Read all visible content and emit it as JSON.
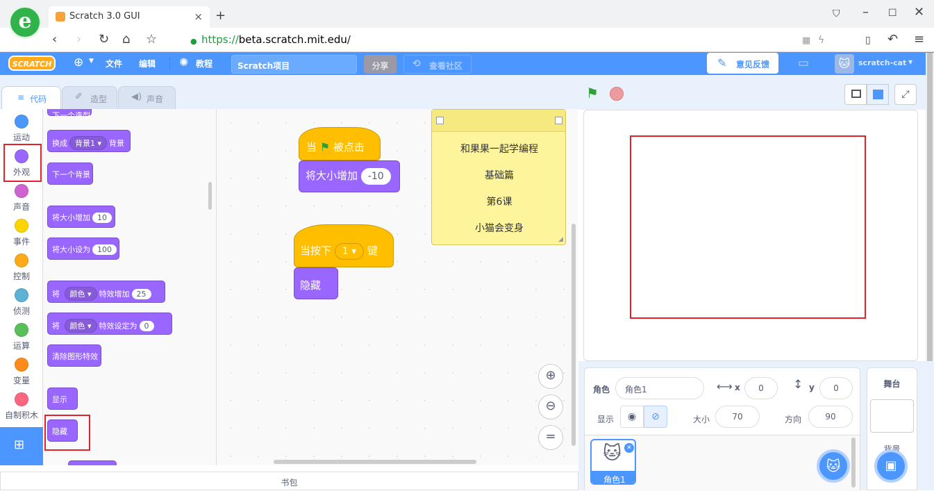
{
  "browser": {
    "tab_title": "Scratch 3.0 GUI",
    "url_scheme": "https://",
    "url_host": "beta.scratch.mit.edu",
    "url_path": "/"
  },
  "menubar": {
    "logo": "SCRATCH",
    "file": "文件",
    "edit": "编辑",
    "tutorials": "教程",
    "project_title": "Scratch项目",
    "share": "分享",
    "see_community": "查看社区",
    "feedback": "意见反馈",
    "username": "scratch-cat"
  },
  "editor_tabs": [
    "代码",
    "造型",
    "声音"
  ],
  "categories": [
    {
      "label": "运动",
      "color": "#4c97ff"
    },
    {
      "label": "外观",
      "color": "#9966ff"
    },
    {
      "label": "声音",
      "color": "#cf63cf"
    },
    {
      "label": "事件",
      "color": "#ffd500"
    },
    {
      "label": "控制",
      "color": "#ffab19"
    },
    {
      "label": "侦测",
      "color": "#5cb1d6"
    },
    {
      "label": "运算",
      "color": "#59c059"
    },
    {
      "label": "变量",
      "color": "#ff8c1a"
    },
    {
      "label": "自制积木",
      "color": "#ff6680"
    }
  ],
  "palette": {
    "top_cut": "下一个造型",
    "switch_backdrop": {
      "pre": "换成",
      "dropdown": "背景1",
      "post": "背景"
    },
    "next_backdrop": "下一个背景",
    "change_size": {
      "label": "将大小增加",
      "value": "10"
    },
    "set_size": {
      "label": "将大小设为",
      "value": "100"
    },
    "change_effect": {
      "pre": "将",
      "dropdown": "颜色",
      "post": "特效增加",
      "value": "25"
    },
    "set_effect": {
      "pre": "将",
      "dropdown": "颜色",
      "post": "特效设定为",
      "value": "0"
    },
    "clear_effects": "清除图形特效",
    "show": "显示",
    "hide": "隐藏"
  },
  "workspace": {
    "script1": {
      "hat_pre": "当",
      "hat_post": "被点击",
      "block": "将大小增加",
      "value": "-10"
    },
    "script2": {
      "hat_pre": "当按下",
      "key": "1",
      "hat_post": "键",
      "block": "隐藏"
    },
    "note_lines": [
      "和果果一起学编程",
      "基础篇",
      "第6课",
      "小猫会变身"
    ]
  },
  "backpack": "书包",
  "sprite_info": {
    "sprite_label": "角色",
    "sprite_name": "角色1",
    "x_label": "x",
    "x": "0",
    "y_label": "y",
    "y": "0",
    "show_label": "显示",
    "size_label": "大小",
    "size": "70",
    "direction_label": "方向",
    "direction": "90"
  },
  "sprite_tile": "角色1",
  "stage_panel": {
    "title": "舞台",
    "backdrop_label": "背景"
  },
  "colors": {
    "scratch_blue": "#4c97ff",
    "looks_purple": "#9966ff",
    "events_yellow": "#ffbf00",
    "highlight_red": "#e3212b"
  }
}
